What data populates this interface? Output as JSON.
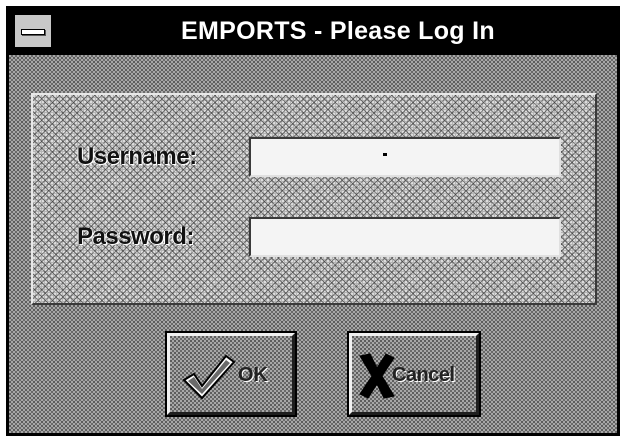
{
  "window": {
    "title": "EMPORTS - Please Log In"
  },
  "form": {
    "username_label": "Username:",
    "username_value": "",
    "password_label": "Password:",
    "password_value": ""
  },
  "buttons": {
    "ok_label": "OK",
    "cancel_label": "Cancel"
  },
  "icons": {
    "system_menu": "system-menu-icon",
    "ok": "checkmark-icon",
    "cancel": "x-mark-icon"
  }
}
